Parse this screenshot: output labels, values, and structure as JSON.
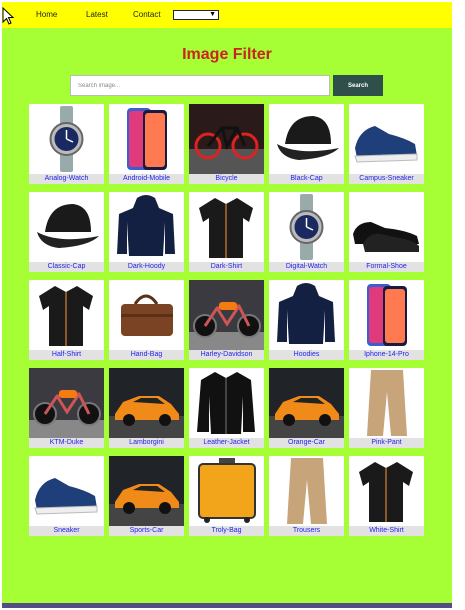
{
  "nav": {
    "links": [
      "Home",
      "Latest",
      "Contact"
    ],
    "dropdown_value": ""
  },
  "page": {
    "title": "Image Filter",
    "title_color": "#cc2222",
    "background": "#a6ff34",
    "navbar_color": "#ffff00"
  },
  "search": {
    "placeholder": "Search image...",
    "value": "",
    "button_label": "Search"
  },
  "products": [
    {
      "label": "Analog-Watch",
      "icon": "watch-image"
    },
    {
      "label": "Android-Mobile",
      "icon": "phone-image"
    },
    {
      "label": "Bicycle",
      "icon": "bicycle-image"
    },
    {
      "label": "Black-Cap",
      "icon": "cap-image"
    },
    {
      "label": "Campus-Sneaker",
      "icon": "sneaker-image"
    },
    {
      "label": "Classic-Cap",
      "icon": "cap-image"
    },
    {
      "label": "Dark-Hoody",
      "icon": "hoodie-image"
    },
    {
      "label": "Dark-Shirt",
      "icon": "shirt-image"
    },
    {
      "label": "Digital-Watch",
      "icon": "watch-image"
    },
    {
      "label": "Formal-Shoe",
      "icon": "shoe-image"
    },
    {
      "label": "Half-Shirt",
      "icon": "shirt-image"
    },
    {
      "label": "Hand-Bag",
      "icon": "bag-image"
    },
    {
      "label": "Harley-Davidson",
      "icon": "motorcycle-image"
    },
    {
      "label": "Hoodies",
      "icon": "hoodie-image"
    },
    {
      "label": "Iphone-14-Pro",
      "icon": "phone-image"
    },
    {
      "label": "KTM-Duke",
      "icon": "motorcycle-image"
    },
    {
      "label": "Lamborgini",
      "icon": "car-image"
    },
    {
      "label": "Leather-Jacket",
      "icon": "jacket-image"
    },
    {
      "label": "Orange-Car",
      "icon": "car-image"
    },
    {
      "label": "Pink-Pant",
      "icon": "pant-image"
    },
    {
      "label": "Sneaker",
      "icon": "sneaker-image"
    },
    {
      "label": "Sports-Car",
      "icon": "car-image"
    },
    {
      "label": "Troly-Bag",
      "icon": "luggage-image"
    },
    {
      "label": "Trousers",
      "icon": "pant-image"
    },
    {
      "label": "White-Shirt",
      "icon": "shirt-image"
    }
  ]
}
